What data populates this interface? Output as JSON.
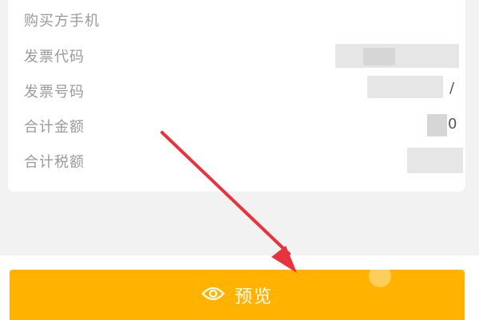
{
  "fields": [
    {
      "label": "购买方手机",
      "value": ""
    },
    {
      "label": "发票代码",
      "value": ""
    },
    {
      "label": "发票号码",
      "value": "/"
    },
    {
      "label": "合计金额",
      "value": "0"
    },
    {
      "label": "合计税额",
      "value": ""
    }
  ],
  "preview_button": {
    "label": "预览",
    "icon": "eye-icon"
  },
  "colors": {
    "accent": "#ffb300",
    "arrow": "#e8323c",
    "label": "#9a9a9a"
  }
}
